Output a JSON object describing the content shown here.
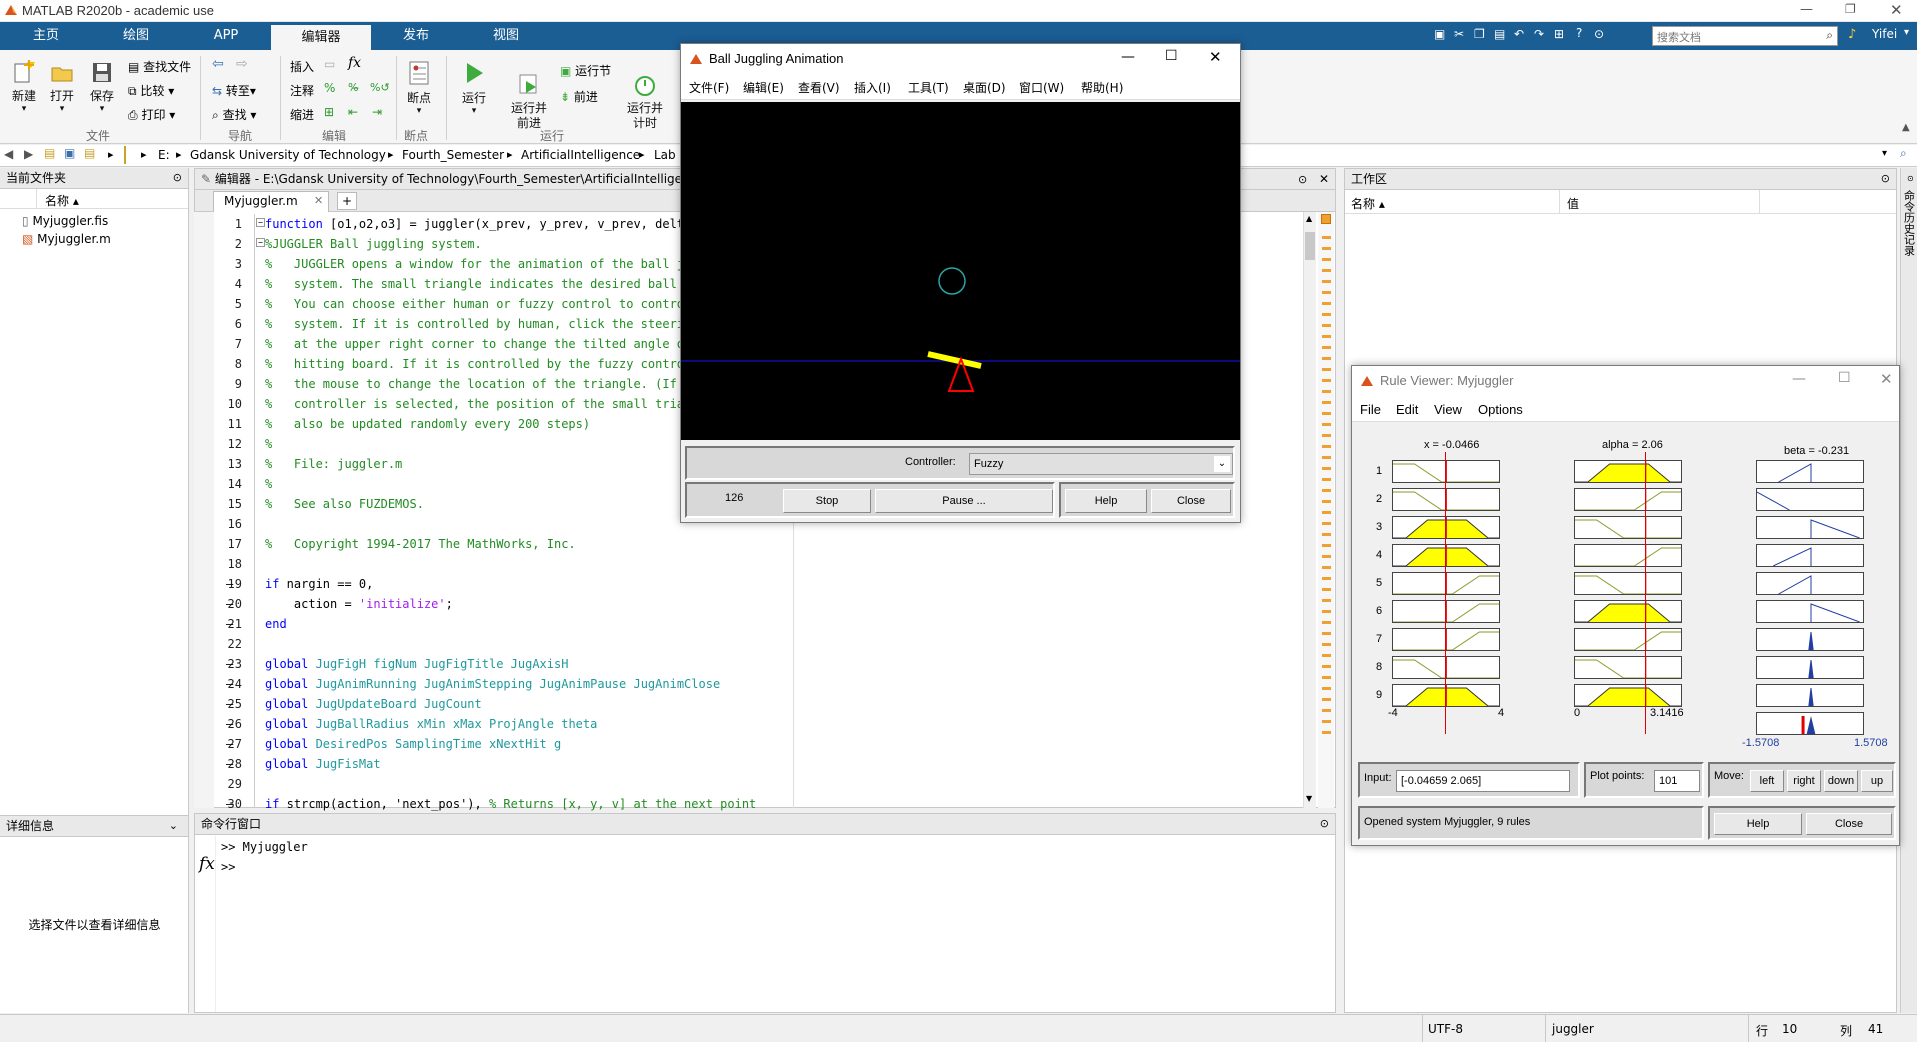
{
  "app": {
    "title": "MATLAB R2020b - academic use"
  },
  "tabs": [
    "主页",
    "绘图",
    "APP",
    "编辑器",
    "发布",
    "视图"
  ],
  "search": {
    "placeholder": "搜索文档"
  },
  "user": {
    "name": "Yifei"
  },
  "ribbon": {
    "file": {
      "new": "新建",
      "open": "打开",
      "save": "保存",
      "find_files": "查找文件",
      "compare": "比较",
      "print": "打印",
      "group": "文件"
    },
    "nav": {
      "goto": "转至",
      "find": "查找",
      "group": "导航"
    },
    "edit": {
      "insert": "插入",
      "comment": "注释",
      "indent": "缩进",
      "group": "编辑"
    },
    "breakpoints": {
      "label": "断点",
      "group": "断点"
    },
    "run": {
      "run": "运行",
      "run_advance": "运行并\n前进",
      "run_section": "运行节",
      "advance": "前进",
      "run_time": "运行并\n计时",
      "group": "运行"
    }
  },
  "address": {
    "parts": [
      "E:",
      "E:",
      "Gdansk University of Technology",
      "Fourth_Semester",
      "ArtificialIntelligence",
      "Lab"
    ]
  },
  "current_folder": {
    "title": "当前文件夹",
    "col_name": "名称 ▴",
    "files": [
      "Myjuggler.fis",
      "Myjuggler.m"
    ]
  },
  "details": {
    "title": "详细信息",
    "hint": "选择文件以查看详细信息"
  },
  "editor": {
    "title": "编辑器 - E:\\Gdansk University of Technology\\Fourth_Semester\\ArtificialIntelligen",
    "tab": "Myjuggler.m",
    "lines": [
      "function [o1,o2,o3] = juggler(x_prev, y_prev, v_prev, delta",
      "%JUGGLER Ball juggling system.",
      "%   JUGGLER opens a window for the animation of the ball ju",
      "%   system. The small triangle indicates the desired ball p",
      "%   You can choose either human or fuzzy control to control",
      "%   system. If it is controlled by human, click the steerin",
      "%   at the upper right corner to change the tilted angle of",
      "%   hitting board. If it is controlled by the fuzzy control",
      "%   the mouse to change the location of the triangle. (If f",
      "%   controller is selected, the position of the small trian",
      "%   also be updated randomly every 200 steps)",
      "%",
      "%   File: juggler.m",
      "%",
      "%   See also FUZDEMOS.",
      "",
      "%   Copyright 1994-2017 The MathWorks, Inc.",
      "",
      "if nargin == 0,",
      "    action = 'initialize';",
      "end",
      "",
      "global JugFigH figNum JugFigTitle JugAxisH",
      "global JugAnimRunning JugAnimStepping JugAnimPause JugAnimClose",
      "global JugUpdateBoard JugCount",
      "global JugBallRadius xMin xMax ProjAngle theta",
      "global DesiredPos SamplingTime xNextHit g",
      "global JugFisMat",
      "",
      "if strcmp(action, 'next_pos'), % Returns [x, y, v] at the next point"
    ],
    "numbers": [
      "1",
      "2",
      "3",
      "4",
      "5",
      "6",
      "7",
      "8",
      "9",
      "10",
      "11",
      "12",
      "13",
      "14",
      "15",
      "16",
      "17",
      "18",
      "19",
      "20",
      "21",
      "22",
      "23",
      "24",
      "25",
      "26",
      "27",
      "28",
      "29",
      "30"
    ]
  },
  "command": {
    "title": "命令行窗口",
    "history": ">> Myjuggler",
    "prompt": ">>",
    "fx": "fx"
  },
  "workspace": {
    "title": "工作区",
    "col_name": "名称 ▴",
    "col_value": "值"
  },
  "side_tab": "命令历史记录",
  "status": {
    "encoding": "UTF-8",
    "file": "juggler",
    "row_label": "行",
    "row": "10",
    "col_label": "列",
    "col": "41"
  },
  "anim": {
    "title": "Ball Juggling Animation",
    "menu": [
      "文件(F)",
      "编辑(E)",
      "查看(V)",
      "插入(I)",
      "工具(T)",
      "桌面(D)",
      "窗口(W)",
      "帮助(H)"
    ],
    "controller_label": "Controller:",
    "controller_value": "Fuzzy",
    "count": "126",
    "buttons": {
      "stop": "Stop",
      "pause": "Pause ...",
      "help": "Help",
      "close": "Close"
    },
    "colors": {
      "ball": "#2aa6a6",
      "board": "#ffff00",
      "triangle": "#ff0000",
      "ground": "#1010a0"
    }
  },
  "rule": {
    "title": "Rule Viewer: Myjuggler",
    "menu": [
      "File",
      "Edit",
      "View",
      "Options"
    ],
    "vars": [
      "x = -0.0466",
      "alpha = 2.06",
      "beta = -0.231"
    ],
    "rules": [
      "1",
      "2",
      "3",
      "4",
      "5",
      "6",
      "7",
      "8",
      "9"
    ],
    "ranges": {
      "x_min": "-4",
      "x_max": "4",
      "alpha_min": "0",
      "alpha_max": "3.1416",
      "beta_min": "-1.5708",
      "beta_max": "1.5708"
    },
    "input_label": "Input:",
    "input_value": "[-0.04659 2.065]",
    "plot_points_label": "Plot points:",
    "plot_points_value": "101",
    "move_label": "Move:",
    "move": [
      "left",
      "right",
      "down",
      "up"
    ],
    "status": "Opened system Myjuggler, 9 rules",
    "help": "Help",
    "close": "Close",
    "input_x": -0.0466,
    "input_alpha": 2.06,
    "output_beta": -0.231,
    "x_mf": [
      "low",
      "low",
      "mid",
      "mid",
      "high",
      "high",
      "high",
      "low",
      "mid"
    ],
    "alpha_mf": [
      "mid",
      "high",
      "low",
      "high",
      "low",
      "mid",
      "high",
      "low",
      "mid"
    ],
    "beta_mf": [
      "pos",
      "neg",
      "negtri",
      "postri",
      "pos",
      "negtri",
      "zero",
      "zero",
      "zero"
    ]
  }
}
